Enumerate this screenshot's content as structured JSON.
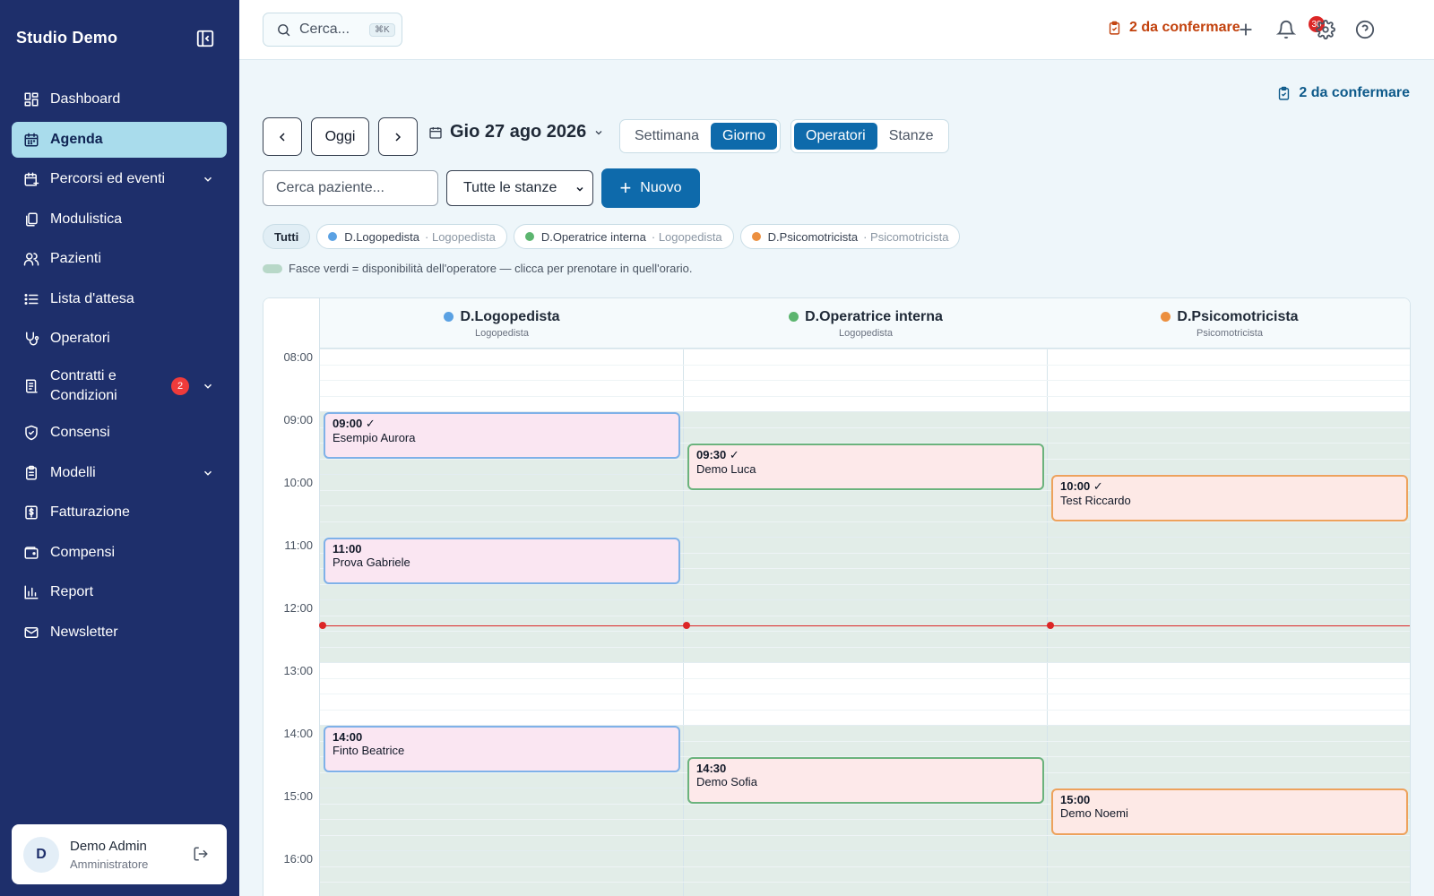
{
  "sidebar": {
    "brand": "Studio Demo",
    "items": [
      {
        "label": "Dashboard",
        "icon": "dashboard-icon"
      },
      {
        "label": "Agenda",
        "icon": "calendar-icon",
        "active": true
      },
      {
        "label": "Percorsi ed eventi",
        "icon": "calendar-plus-icon",
        "expandable": true
      },
      {
        "label": "Modulistica",
        "icon": "documents-icon"
      },
      {
        "label": "Pazienti",
        "icon": "users-icon"
      },
      {
        "label": "Lista d'attesa",
        "icon": "list-icon"
      },
      {
        "label": "Operatori",
        "icon": "stethoscope-icon"
      },
      {
        "label": "Contratti e Condizioni",
        "icon": "contract-icon",
        "expandable": true,
        "badge": "2"
      },
      {
        "label": "Consensi",
        "icon": "shield-check-icon"
      },
      {
        "label": "Modelli",
        "icon": "clipboard-icon",
        "expandable": true
      },
      {
        "label": "Fatturazione",
        "icon": "invoice-icon"
      },
      {
        "label": "Compensi",
        "icon": "wallet-icon"
      },
      {
        "label": "Report",
        "icon": "bar-chart-icon"
      },
      {
        "label": "Newsletter",
        "icon": "mail-icon"
      }
    ],
    "user": {
      "initial": "D",
      "name": "Demo Admin",
      "role": "Amministratore"
    }
  },
  "topbar": {
    "search_placeholder": "Cerca...",
    "shortcut": "⌘K",
    "pending": "2 da confermare",
    "notifications": "30"
  },
  "main": {
    "pending": "2 da confermare",
    "today": "Oggi",
    "date": "Gio 27 ago 2026",
    "view_modes": [
      "Settimana",
      "Giorno"
    ],
    "active_view": "Giorno",
    "group_modes": [
      "Operatori",
      "Stanze"
    ],
    "active_group": "Operatori",
    "patient_search_placeholder": "Cerca paziente...",
    "room_filter": "Tutte le stanze",
    "new_button": "Nuovo",
    "filter_all": "Tutti",
    "legend_note": "Fasce verdi = disponibilità dell'operatore — clicca per prenotare in quell'orario."
  },
  "colors": {
    "sidebar_bg": "#1e2f6b",
    "accent": "#0e6aab",
    "op_blue": "#5aa1e3",
    "op_green": "#5cb56f",
    "op_orange": "#ec8f3f",
    "now_line": "#dc2626"
  },
  "operators": [
    {
      "name": "D.Logopedista",
      "role": "Logopedista",
      "color": "#5aa1e3"
    },
    {
      "name": "D.Operatrice interna",
      "role": "Logopedista",
      "color": "#5cb56f"
    },
    {
      "name": "D.Psicomotricista",
      "role": "Psicomotricista",
      "color": "#ec8f3f"
    }
  ],
  "hours": [
    "08:00",
    "09:00",
    "10:00",
    "11:00",
    "12:00",
    "13:00",
    "14:00",
    "15:00",
    "16:00"
  ],
  "current_time": "12:25",
  "availability": [
    [
      [
        "09:00",
        "13:00"
      ],
      [
        "14:00",
        "17:00"
      ]
    ],
    [
      [
        "09:00",
        "13:00"
      ],
      [
        "14:00",
        "17:00"
      ]
    ],
    [
      [
        "09:00",
        "13:00"
      ],
      [
        "14:00",
        "17:00"
      ]
    ]
  ],
  "appointments": [
    {
      "operator": 0,
      "start": "09:00",
      "end": "09:45",
      "time": "09:00 ✓",
      "patient": "Esempio Aurora"
    },
    {
      "operator": 0,
      "start": "11:00",
      "end": "11:45",
      "time": "11:00",
      "patient": "Prova Gabriele"
    },
    {
      "operator": 0,
      "start": "14:00",
      "end": "14:45",
      "time": "14:00",
      "patient": "Finto Beatrice"
    },
    {
      "operator": 1,
      "start": "09:30",
      "end": "10:15",
      "time": "09:30 ✓",
      "patient": "Demo Luca"
    },
    {
      "operator": 1,
      "start": "14:30",
      "end": "15:15",
      "time": "14:30",
      "patient": "Demo Sofia"
    },
    {
      "operator": 2,
      "start": "10:00",
      "end": "10:45",
      "time": "10:00 ✓",
      "patient": "Test Riccardo"
    },
    {
      "operator": 2,
      "start": "15:00",
      "end": "15:45",
      "time": "15:00",
      "patient": "Demo Noemi"
    }
  ]
}
